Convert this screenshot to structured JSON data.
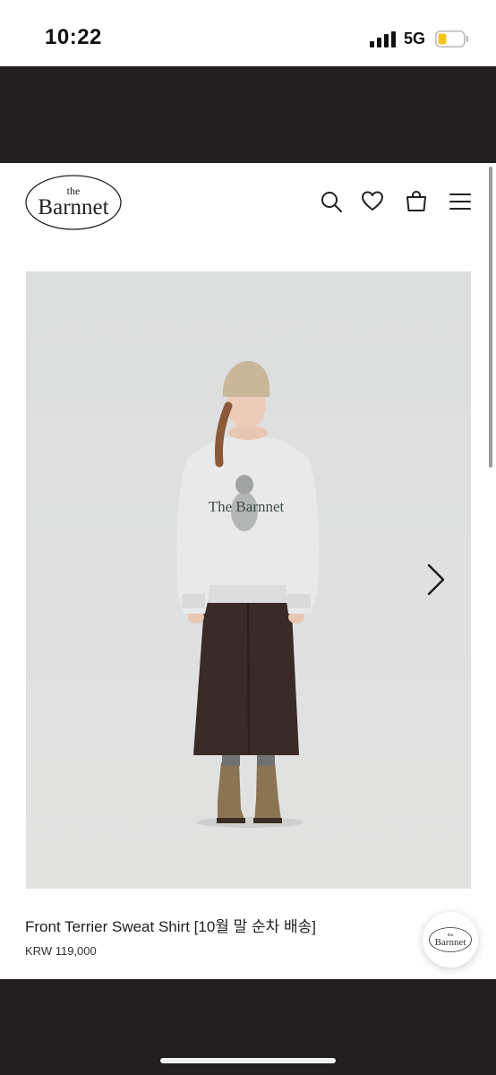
{
  "status_bar": {
    "time": "10:22",
    "network": "5G",
    "signal_icon": "signal-bars-icon",
    "battery_icon": "battery-low-icon"
  },
  "header": {
    "logo": {
      "small_text": "the",
      "name": "Barnnet"
    },
    "icons": [
      "search-icon",
      "heart-icon",
      "shopping-bag-icon",
      "hamburger-menu-icon"
    ]
  },
  "gallery": {
    "photo_print": "The Barnnet",
    "next_icon": "chevron-right-icon"
  },
  "product": {
    "title": "Front Terrier Sweat Shirt [10월 말 순차 배송]",
    "price": "KRW 119,000"
  },
  "floating_button": {
    "small_text": "the",
    "name": "Barnnet"
  },
  "colors": {
    "dark_band": "#231f20",
    "photo_bg": "#dedfde",
    "battery_fill": "#f4c41a",
    "text": "#1e1e1e"
  }
}
